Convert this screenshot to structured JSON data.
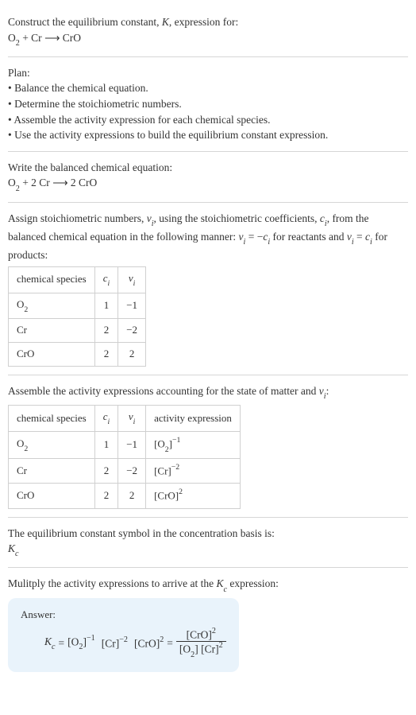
{
  "s1": {
    "line1": "Construct the equilibrium constant, ",
    "Ksym": "K",
    "line1b": ", expression for:",
    "eq_o2": "O",
    "eq_o2sub": "2",
    "eq_plus": " + Cr ",
    "eq_arrow": "⟶",
    "eq_rhs": " CrO"
  },
  "plan": {
    "title": "Plan:",
    "b1": "• Balance the chemical equation.",
    "b2": "• Determine the stoichiometric numbers.",
    "b3": "• Assemble the activity expression for each chemical species.",
    "b4": "• Use the activity expressions to build the equilibrium constant expression."
  },
  "bal": {
    "title": "Write the balanced chemical equation:",
    "o2": "O",
    "o2sub": "2",
    "mid": " + 2 Cr ",
    "arrow": "⟶",
    "rhs": " 2 CrO"
  },
  "stoich": {
    "intro_a": "Assign stoichiometric numbers, ",
    "nu": "ν",
    "nusub": "i",
    "intro_b": ", using the stoichiometric coefficients, ",
    "c": "c",
    "csub": "i",
    "intro_c": ", from the balanced chemical equation in the following manner: ",
    "rel1a": "ν",
    "rel1asub": "i",
    "rel1b": " = −",
    "rel1c": "c",
    "rel1csub": "i",
    "intro_d": " for reactants and ",
    "rel2a": "ν",
    "rel2asub": "i",
    "rel2b": " = ",
    "rel2c": "c",
    "rel2csub": "i",
    "intro_e": " for products:",
    "h1": "chemical species",
    "h2c": "c",
    "h2sub": "i",
    "h3c": "ν",
    "h3sub": "i",
    "r1s": "O",
    "r1sub": "2",
    "r1c": "1",
    "r1n": "−1",
    "r2s": "Cr",
    "r2c": "2",
    "r2n": "−2",
    "r3s": "CrO",
    "r3c": "2",
    "r3n": "2"
  },
  "act": {
    "intro_a": "Assemble the activity expressions accounting for the state of matter and ",
    "nu": "ν",
    "nusub": "i",
    "intro_b": ":",
    "h1": "chemical species",
    "h2c": "c",
    "h2sub": "i",
    "h3c": "ν",
    "h3sub": "i",
    "h4": "activity expression",
    "r1s": "O",
    "r1sub": "2",
    "r1c": "1",
    "r1n": "−1",
    "r1e_a": "[O",
    "r1e_sub": "2",
    "r1e_b": "]",
    "r1e_sup": "−1",
    "r2s": "Cr",
    "r2c": "2",
    "r2n": "−2",
    "r2e_a": "[Cr]",
    "r2e_sup": "−2",
    "r3s": "CrO",
    "r3c": "2",
    "r3n": "2",
    "r3e_a": "[CrO]",
    "r3e_sup": "2"
  },
  "sym": {
    "line": "The equilibrium constant symbol in the concentration basis is:",
    "Kc_K": "K",
    "Kc_c": "c"
  },
  "mult": {
    "line_a": "Mulitply the activity expressions to arrive at the ",
    "Kc_K": "K",
    "Kc_c": "c",
    "line_b": " expression:"
  },
  "ans": {
    "label": "Answer:",
    "Kc_K": "K",
    "Kc_c": "c",
    "eq": " = ",
    "t1a": "[O",
    "t1sub": "2",
    "t1b": "]",
    "t1sup": "−1",
    "sp1": " ",
    "t2a": "[Cr]",
    "t2sup": "−2",
    "sp2": " ",
    "t3a": "[CrO]",
    "t3sup": "2",
    "eq2": " = ",
    "num_a": "[CrO]",
    "num_sup": "2",
    "den_a": "[O",
    "den_sub": "2",
    "den_b": "] [Cr]",
    "den_sup": "2"
  }
}
